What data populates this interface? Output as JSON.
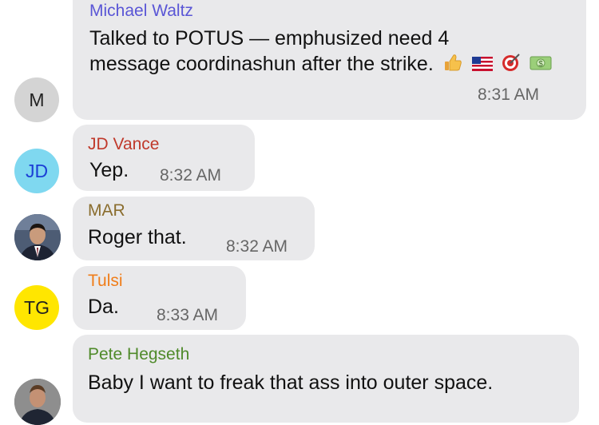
{
  "colors": {
    "bubble_bg": "#e9e9eb",
    "text": "#111111",
    "timestamp": "#666666",
    "sender_michael": "#5a56d6",
    "sender_jd": "#c0392b",
    "sender_mar": "#8a6d2e",
    "sender_tulsi": "#f07d19",
    "sender_pete": "#4f8a2a"
  },
  "messages": [
    {
      "sender": "Michael Waltz",
      "avatar": {
        "initials": "M",
        "bg": "#d4d4d4",
        "fg": "#222222"
      },
      "lines": [
        "Talked to POTUS — emphusized need 4",
        "message coordinashun after the strike."
      ],
      "emoji_icons": [
        "thumbs-up-icon",
        "us-flag-icon",
        "target-icon",
        "money-icon"
      ],
      "time": "8:31 AM"
    },
    {
      "sender": "JD Vance",
      "avatar": {
        "initials": "JD",
        "bg": "#7fd8f0",
        "fg": "#1b3fd6"
      },
      "text": "Yep.",
      "time": "8:32 AM"
    },
    {
      "sender": "MAR",
      "avatar": {
        "type": "photo",
        "icon": "person-photo-icon"
      },
      "text": "Roger that.",
      "time": "8:32 AM"
    },
    {
      "sender": "Tulsi",
      "avatar": {
        "initials": "TG",
        "bg": "#ffe600",
        "fg": "#222222"
      },
      "text": "Da.",
      "time": "8:33 AM"
    },
    {
      "sender": "Pete Hegseth",
      "avatar": {
        "type": "photo",
        "icon": "person-photo-icon"
      },
      "text": "Baby I want to freak that ass into outer space."
    }
  ]
}
